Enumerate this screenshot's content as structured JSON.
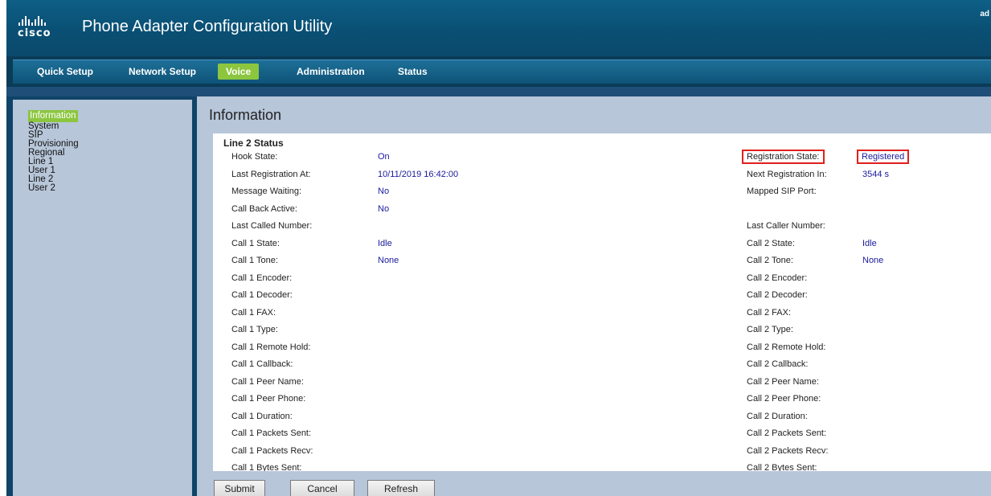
{
  "header": {
    "logo_text": "cisco",
    "title": "Phone Adapter Configuration Utility",
    "user_corner": "ad"
  },
  "tabs": [
    {
      "label": "Quick Setup"
    },
    {
      "label": "Network Setup"
    },
    {
      "label": "Voice",
      "active": true
    },
    {
      "label": "Administration"
    },
    {
      "label": "Status"
    }
  ],
  "sidebar": {
    "items": [
      {
        "label": "Information",
        "active": true
      },
      {
        "label": "System"
      },
      {
        "label": "SIP"
      },
      {
        "label": "Provisioning"
      },
      {
        "label": "Regional"
      },
      {
        "label": "Line 1"
      },
      {
        "label": "User 1"
      },
      {
        "label": "Line 2"
      },
      {
        "label": "User 2"
      }
    ]
  },
  "main": {
    "page_title": "Information",
    "section_title": "Line 2 Status",
    "rows": [
      {
        "l1": "Hook State:",
        "v1": "On",
        "l2": "Registration State:",
        "v2": "Registered",
        "hl": true
      },
      {
        "l1": "Last Registration At:",
        "v1": "10/11/2019 16:42:00",
        "l2": "Next Registration In:",
        "v2": "3544 s"
      },
      {
        "l1": "Message Waiting:",
        "v1": "No",
        "l2": "Mapped SIP Port:",
        "v2": ""
      },
      {
        "l1": "Call Back Active:",
        "v1": "No",
        "l2": "",
        "v2": ""
      },
      {
        "l1": "Last Called Number:",
        "v1": "",
        "l2": "Last Caller Number:",
        "v2": ""
      },
      {
        "l1": "Call 1 State:",
        "v1": "Idle",
        "l2": "Call 2 State:",
        "v2": "Idle"
      },
      {
        "l1": "Call 1 Tone:",
        "v1": "None",
        "l2": "Call 2 Tone:",
        "v2": "None"
      },
      {
        "l1": "Call 1 Encoder:",
        "v1": "",
        "l2": "Call 2 Encoder:",
        "v2": ""
      },
      {
        "l1": "Call 1 Decoder:",
        "v1": "",
        "l2": "Call 2 Decoder:",
        "v2": ""
      },
      {
        "l1": "Call 1 FAX:",
        "v1": "",
        "l2": "Call 2 FAX:",
        "v2": ""
      },
      {
        "l1": "Call 1 Type:",
        "v1": "",
        "l2": "Call 2 Type:",
        "v2": ""
      },
      {
        "l1": "Call 1 Remote Hold:",
        "v1": "",
        "l2": "Call 2 Remote Hold:",
        "v2": ""
      },
      {
        "l1": "Call 1 Callback:",
        "v1": "",
        "l2": "Call 2 Callback:",
        "v2": ""
      },
      {
        "l1": "Call 1 Peer Name:",
        "v1": "",
        "l2": "Call 2 Peer Name:",
        "v2": ""
      },
      {
        "l1": "Call 1 Peer Phone:",
        "v1": "",
        "l2": "Call 2 Peer Phone:",
        "v2": ""
      },
      {
        "l1": "Call 1 Duration:",
        "v1": "",
        "l2": "Call 2 Duration:",
        "v2": ""
      },
      {
        "l1": "Call 1 Packets Sent:",
        "v1": "",
        "l2": "Call 2 Packets Sent:",
        "v2": ""
      },
      {
        "l1": "Call 1 Packets Recv:",
        "v1": "",
        "l2": "Call 2 Packets Recv:",
        "v2": ""
      },
      {
        "l1": "Call 1 Bytes Sent:",
        "v1": "",
        "l2": "Call 2 Bytes Sent:",
        "v2": ""
      }
    ]
  },
  "buttons": {
    "submit": "Submit",
    "cancel": "Cancel",
    "refresh": "Refresh"
  },
  "colors": {
    "active_tab": "#8cc63f",
    "header_blue": "#0a4f74",
    "value_blue": "#1a1a9c",
    "highlight_red": "#e0201c"
  }
}
